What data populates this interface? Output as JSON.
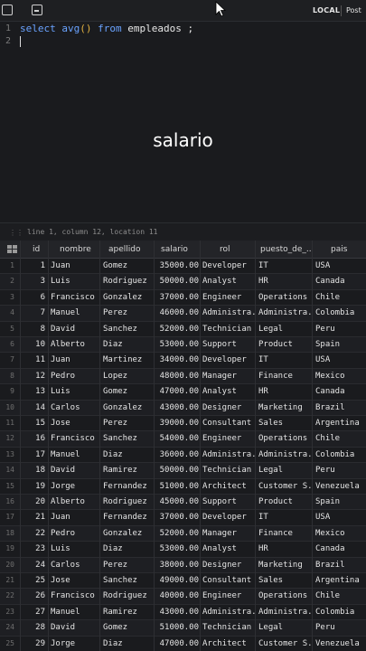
{
  "toolbar": {
    "environment": "LOCAL",
    "connection": "Post"
  },
  "editor": {
    "line_numbers": [
      "1",
      "2"
    ],
    "tokens": {
      "select": "select",
      "fn": "avg",
      "parens": "()",
      "from": "from",
      "table": "empleados ;"
    }
  },
  "overlay_caption": "salario",
  "status": {
    "position": "line 1, column 12, location 11"
  },
  "results": {
    "columns": [
      "id",
      "nombre",
      "apellido",
      "salario",
      "rol",
      "puesto_de_...",
      "pais"
    ],
    "rows": [
      {
        "rn": "1",
        "id": "1",
        "nombre": "Juan",
        "apellido": "Gomez",
        "salario": "35000.00",
        "rol": "Developer",
        "puesto": "IT",
        "pais": "USA"
      },
      {
        "rn": "2",
        "id": "3",
        "nombre": "Luis",
        "apellido": "Rodriguez",
        "salario": "50000.00",
        "rol": "Analyst",
        "puesto": "HR",
        "pais": "Canada"
      },
      {
        "rn": "3",
        "id": "6",
        "nombre": "Francisco",
        "apellido": "Gonzalez",
        "salario": "37000.00",
        "rol": "Engineer",
        "puesto": "Operations",
        "pais": "Chile"
      },
      {
        "rn": "4",
        "id": "7",
        "nombre": "Manuel",
        "apellido": "Perez",
        "salario": "46000.00",
        "rol": "Administra...",
        "puesto": "Administra...",
        "pais": "Colombia"
      },
      {
        "rn": "5",
        "id": "8",
        "nombre": "David",
        "apellido": "Sanchez",
        "salario": "52000.00",
        "rol": "Technician",
        "puesto": "Legal",
        "pais": "Peru"
      },
      {
        "rn": "6",
        "id": "10",
        "nombre": "Alberto",
        "apellido": "Diaz",
        "salario": "53000.00",
        "rol": "Support",
        "puesto": "Product",
        "pais": "Spain"
      },
      {
        "rn": "7",
        "id": "11",
        "nombre": "Juan",
        "apellido": "Martinez",
        "salario": "34000.00",
        "rol": "Developer",
        "puesto": "IT",
        "pais": "USA"
      },
      {
        "rn": "8",
        "id": "12",
        "nombre": "Pedro",
        "apellido": "Lopez",
        "salario": "48000.00",
        "rol": "Manager",
        "puesto": "Finance",
        "pais": "Mexico"
      },
      {
        "rn": "9",
        "id": "13",
        "nombre": "Luis",
        "apellido": "Gomez",
        "salario": "47000.00",
        "rol": "Analyst",
        "puesto": "HR",
        "pais": "Canada"
      },
      {
        "rn": "10",
        "id": "14",
        "nombre": "Carlos",
        "apellido": "Gonzalez",
        "salario": "43000.00",
        "rol": "Designer",
        "puesto": "Marketing",
        "pais": "Brazil"
      },
      {
        "rn": "11",
        "id": "15",
        "nombre": "Jose",
        "apellido": "Perez",
        "salario": "39000.00",
        "rol": "Consultant",
        "puesto": "Sales",
        "pais": "Argentina"
      },
      {
        "rn": "12",
        "id": "16",
        "nombre": "Francisco",
        "apellido": "Sanchez",
        "salario": "54000.00",
        "rol": "Engineer",
        "puesto": "Operations",
        "pais": "Chile"
      },
      {
        "rn": "13",
        "id": "17",
        "nombre": "Manuel",
        "apellido": "Diaz",
        "salario": "36000.00",
        "rol": "Administra...",
        "puesto": "Administra...",
        "pais": "Colombia"
      },
      {
        "rn": "14",
        "id": "18",
        "nombre": "David",
        "apellido": "Ramirez",
        "salario": "50000.00",
        "rol": "Technician",
        "puesto": "Legal",
        "pais": "Peru"
      },
      {
        "rn": "15",
        "id": "19",
        "nombre": "Jorge",
        "apellido": "Fernandez",
        "salario": "51000.00",
        "rol": "Architect",
        "puesto": "Customer S...",
        "pais": "Venezuela"
      },
      {
        "rn": "16",
        "id": "20",
        "nombre": "Alberto",
        "apellido": "Rodriguez",
        "salario": "45000.00",
        "rol": "Support",
        "puesto": "Product",
        "pais": "Spain"
      },
      {
        "rn": "17",
        "id": "21",
        "nombre": "Juan",
        "apellido": "Fernandez",
        "salario": "37000.00",
        "rol": "Developer",
        "puesto": "IT",
        "pais": "USA"
      },
      {
        "rn": "18",
        "id": "22",
        "nombre": "Pedro",
        "apellido": "Gonzalez",
        "salario": "52000.00",
        "rol": "Manager",
        "puesto": "Finance",
        "pais": "Mexico"
      },
      {
        "rn": "19",
        "id": "23",
        "nombre": "Luis",
        "apellido": "Diaz",
        "salario": "53000.00",
        "rol": "Analyst",
        "puesto": "HR",
        "pais": "Canada"
      },
      {
        "rn": "20",
        "id": "24",
        "nombre": "Carlos",
        "apellido": "Perez",
        "salario": "38000.00",
        "rol": "Designer",
        "puesto": "Marketing",
        "pais": "Brazil"
      },
      {
        "rn": "21",
        "id": "25",
        "nombre": "Jose",
        "apellido": "Sanchez",
        "salario": "49000.00",
        "rol": "Consultant",
        "puesto": "Sales",
        "pais": "Argentina"
      },
      {
        "rn": "22",
        "id": "26",
        "nombre": "Francisco",
        "apellido": "Rodriguez",
        "salario": "40000.00",
        "rol": "Engineer",
        "puesto": "Operations",
        "pais": "Chile"
      },
      {
        "rn": "23",
        "id": "27",
        "nombre": "Manuel",
        "apellido": "Ramirez",
        "salario": "43000.00",
        "rol": "Administra...",
        "puesto": "Administra...",
        "pais": "Colombia"
      },
      {
        "rn": "24",
        "id": "28",
        "nombre": "David",
        "apellido": "Gomez",
        "salario": "51000.00",
        "rol": "Technician",
        "puesto": "Legal",
        "pais": "Peru"
      },
      {
        "rn": "25",
        "id": "29",
        "nombre": "Jorge",
        "apellido": "Diaz",
        "salario": "47000.00",
        "rol": "Architect",
        "puesto": "Customer S...",
        "pais": "Venezuela"
      }
    ]
  }
}
